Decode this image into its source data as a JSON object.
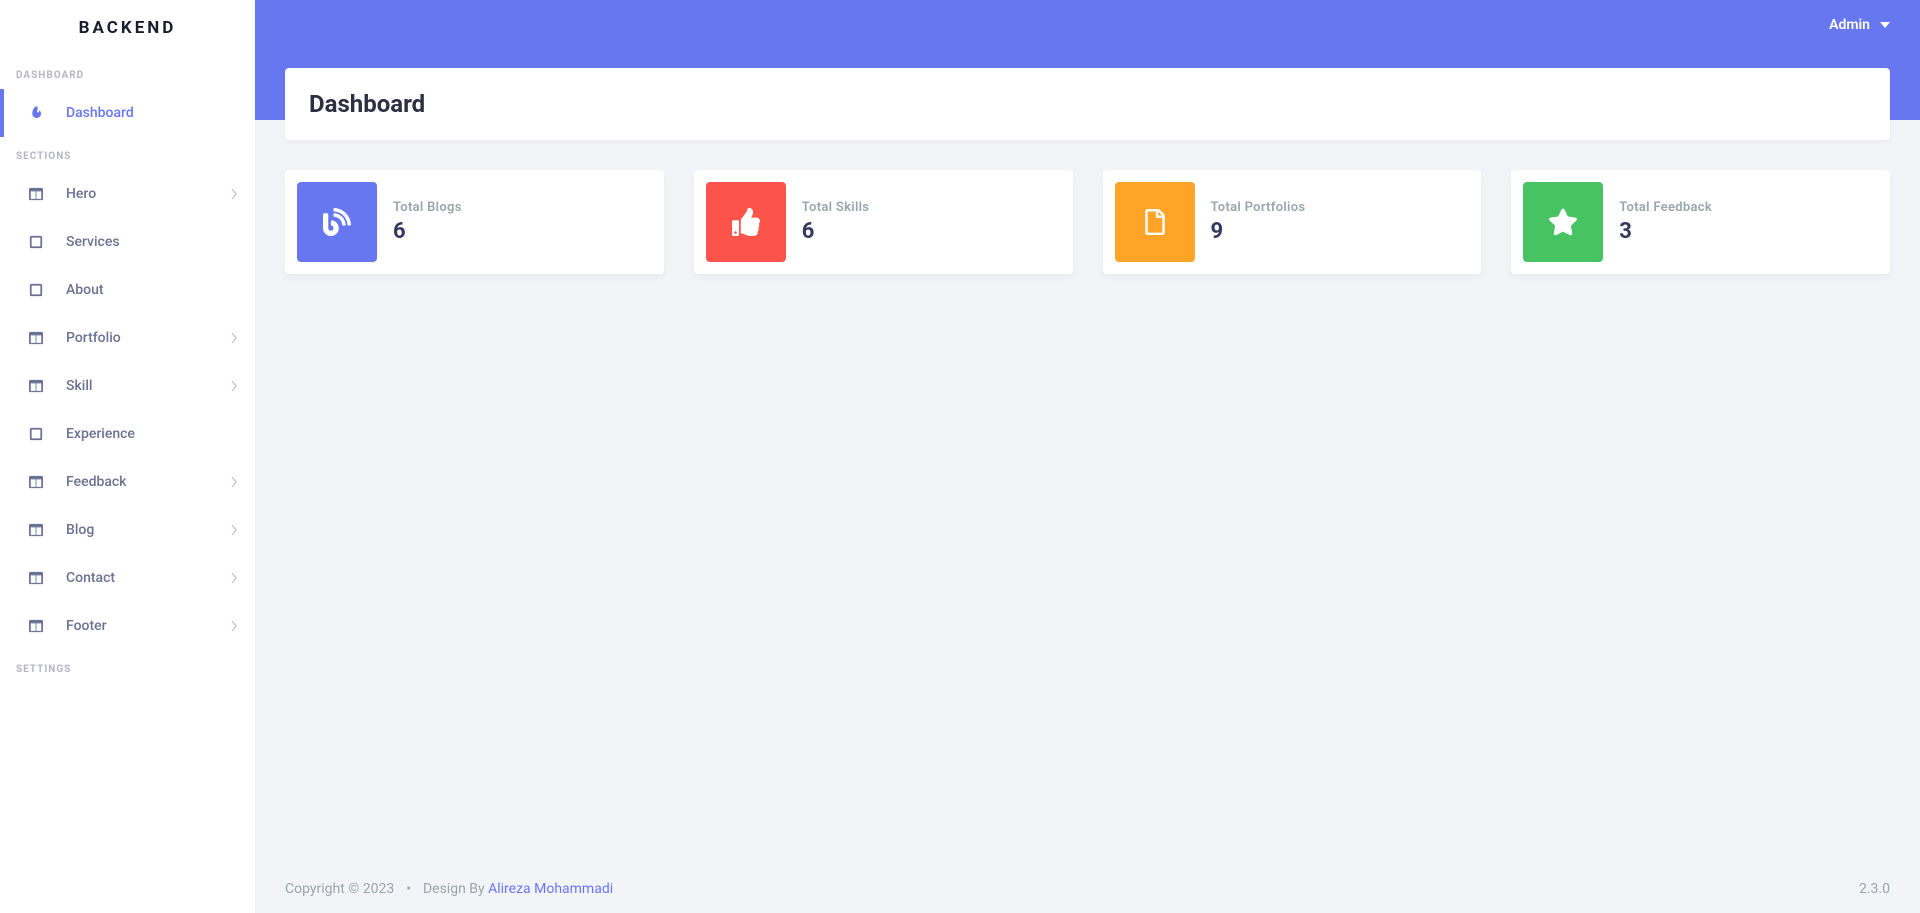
{
  "brand": "BACKEND",
  "sidebar": {
    "groups": [
      {
        "heading": "DASHBOARD",
        "items": [
          {
            "name": "sidebar-item-dashboard",
            "icon": "fire-icon",
            "label": "Dashboard",
            "active": true,
            "expandable": false
          }
        ]
      },
      {
        "heading": "SECTIONS",
        "items": [
          {
            "name": "sidebar-item-hero",
            "icon": "columns-icon",
            "label": "Hero",
            "active": false,
            "expandable": true
          },
          {
            "name": "sidebar-item-services",
            "icon": "square-icon",
            "label": "Services",
            "active": false,
            "expandable": false
          },
          {
            "name": "sidebar-item-about",
            "icon": "square-icon",
            "label": "About",
            "active": false,
            "expandable": false
          },
          {
            "name": "sidebar-item-portfolio",
            "icon": "columns-icon",
            "label": "Portfolio",
            "active": false,
            "expandable": true
          },
          {
            "name": "sidebar-item-skill",
            "icon": "columns-icon",
            "label": "Skill",
            "active": false,
            "expandable": true
          },
          {
            "name": "sidebar-item-experience",
            "icon": "square-icon",
            "label": "Experience",
            "active": false,
            "expandable": false
          },
          {
            "name": "sidebar-item-feedback",
            "icon": "columns-icon",
            "label": "Feedback",
            "active": false,
            "expandable": true
          },
          {
            "name": "sidebar-item-blog",
            "icon": "columns-icon",
            "label": "Blog",
            "active": false,
            "expandable": true
          },
          {
            "name": "sidebar-item-contact",
            "icon": "columns-icon",
            "label": "Contact",
            "active": false,
            "expandable": true
          },
          {
            "name": "sidebar-item-footer",
            "icon": "columns-icon",
            "label": "Footer",
            "active": false,
            "expandable": true
          }
        ]
      },
      {
        "heading": "SETTINGS",
        "items": []
      }
    ]
  },
  "topbar": {
    "user_label": "Admin"
  },
  "page": {
    "title": "Dashboard"
  },
  "cards": [
    {
      "name": "card-total-blogs",
      "label": "Total Blogs",
      "value": "6",
      "icon": "blog-icon",
      "color": "bg-primary"
    },
    {
      "name": "card-total-skills",
      "label": "Total Skills",
      "value": "6",
      "icon": "thumbs-up-icon",
      "color": "bg-danger"
    },
    {
      "name": "card-total-portfolios",
      "label": "Total Portfolios",
      "value": "9",
      "icon": "file-icon",
      "color": "bg-warning"
    },
    {
      "name": "card-total-feedback",
      "label": "Total Feedback",
      "value": "3",
      "icon": "star-icon",
      "color": "bg-success"
    }
  ],
  "footer": {
    "copyright": "Copyright © 2023",
    "design_prefix": "Design By ",
    "designer": "Alireza Mohammadi",
    "version": "2.3.0"
  }
}
